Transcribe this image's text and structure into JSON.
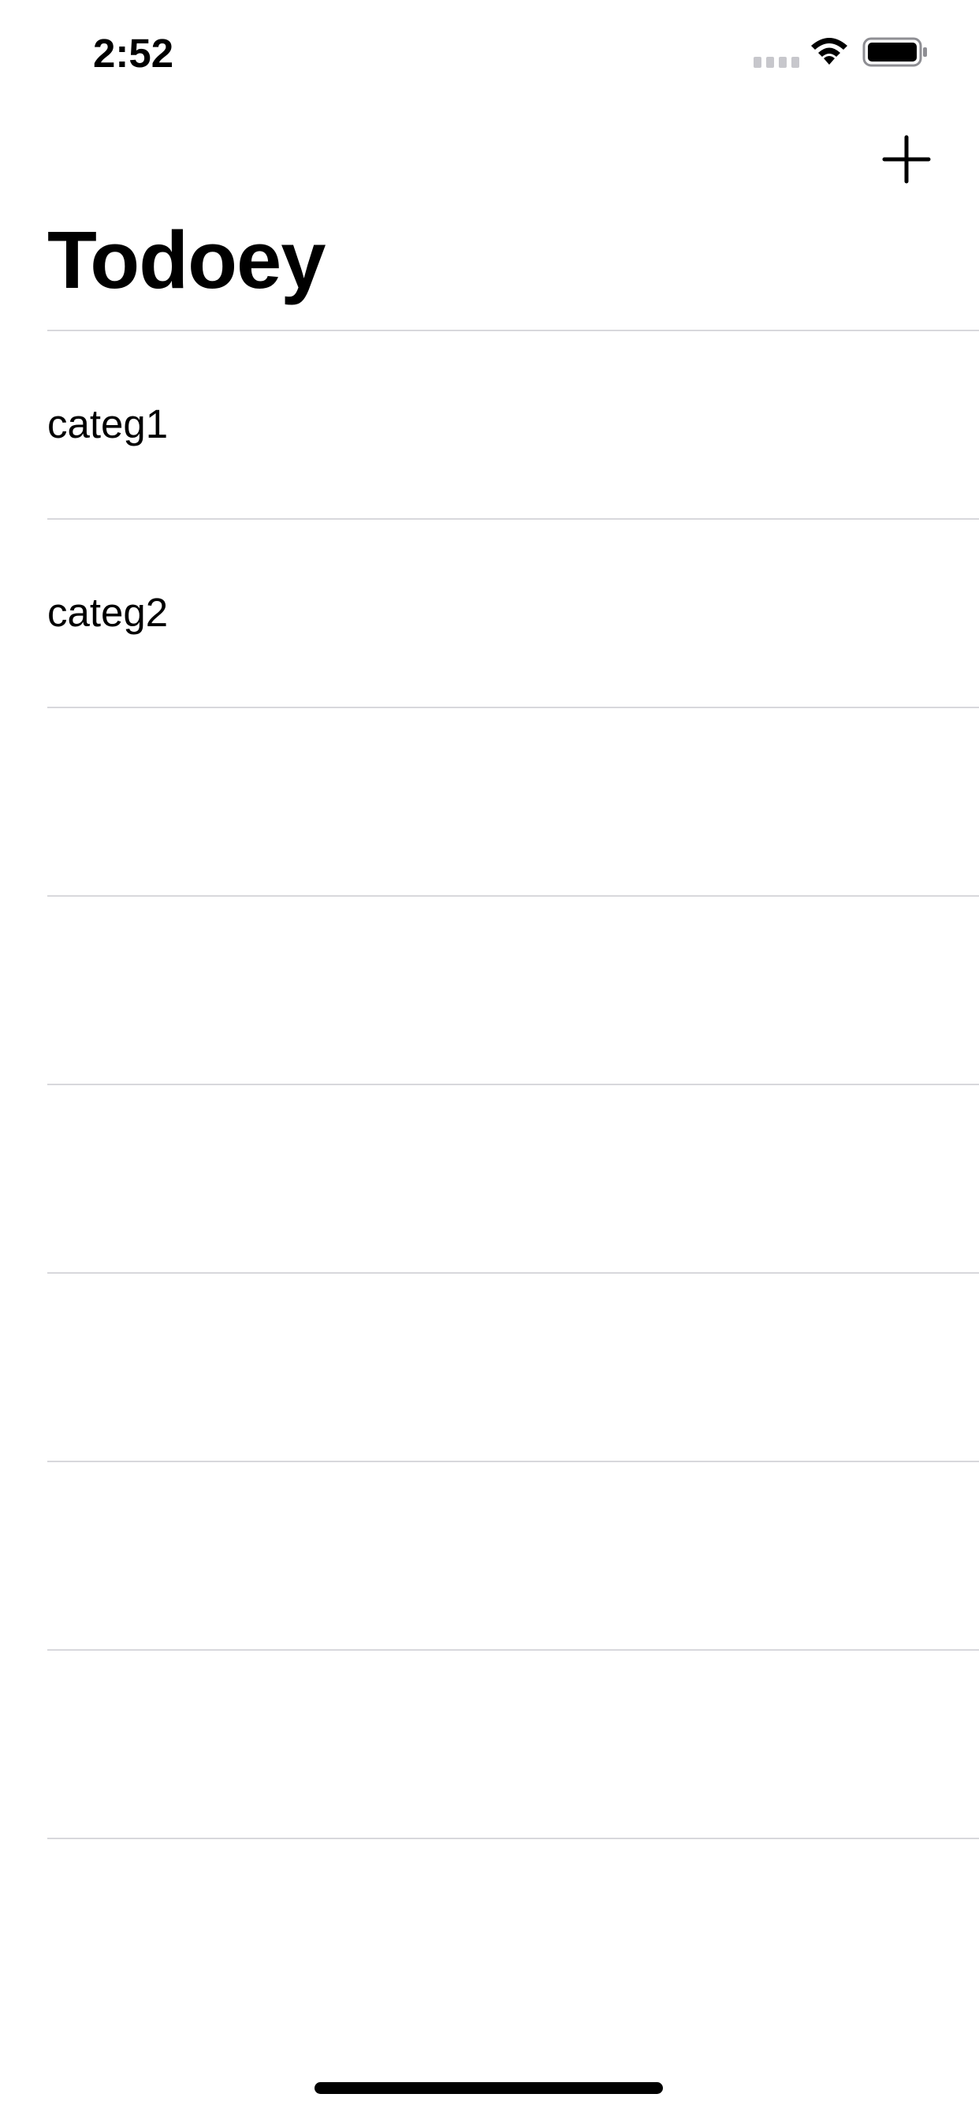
{
  "status_bar": {
    "time": "2:52"
  },
  "nav": {
    "title": "Todoey",
    "add_icon": "plus-icon"
  },
  "categories": [
    {
      "label": "categ1"
    },
    {
      "label": "categ2"
    },
    {
      "label": ""
    },
    {
      "label": ""
    },
    {
      "label": ""
    },
    {
      "label": ""
    },
    {
      "label": ""
    },
    {
      "label": ""
    }
  ],
  "colors": {
    "background": "#ffffff",
    "text": "#000000",
    "separator": "#d8d8dc"
  }
}
